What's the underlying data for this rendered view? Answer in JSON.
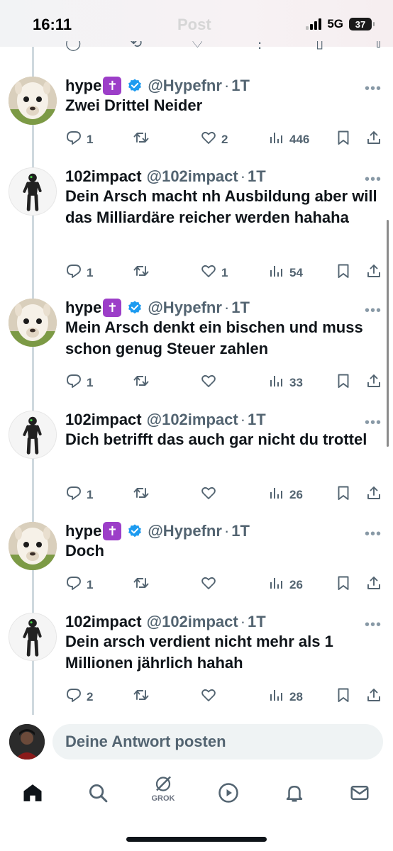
{
  "status_bar": {
    "time": "16:11",
    "ghost_title": "Post",
    "network": "5G",
    "battery": "37"
  },
  "tweets": [
    {
      "author": "hype",
      "emoji": "✝",
      "verified": true,
      "handle": "@Hypefnr",
      "time": "1T",
      "text": "Zwei Drittel Neider",
      "replies": "1",
      "retweets": "",
      "likes": "2",
      "views": "446"
    },
    {
      "author": "102impact",
      "emoji": "",
      "verified": false,
      "handle": "@102impact",
      "time": "1T",
      "text": "Dein Arsch macht nh Ausbildung aber will das Milliardäre reicher werden hahaha",
      "replies": "1",
      "retweets": "",
      "likes": "1",
      "views": "54"
    },
    {
      "author": "hype",
      "emoji": "✝",
      "verified": true,
      "handle": "@Hypefnr",
      "time": "1T",
      "text": "Mein Arsch denkt ein bischen und muss schon genug Steuer zahlen",
      "replies": "1",
      "retweets": "",
      "likes": "",
      "views": "33"
    },
    {
      "author": "102impact",
      "emoji": "",
      "verified": false,
      "handle": "@102impact",
      "time": "1T",
      "text": "Dich betrifft das auch gar nicht du trottel",
      "replies": "1",
      "retweets": "",
      "likes": "",
      "views": "26"
    },
    {
      "author": "hype",
      "emoji": "✝",
      "verified": true,
      "handle": "@Hypefnr",
      "time": "1T",
      "text": "Doch",
      "replies": "1",
      "retweets": "",
      "likes": "",
      "views": "26"
    },
    {
      "author": "102impact",
      "emoji": "",
      "verified": false,
      "handle": "@102impact",
      "time": "1T",
      "text": "Dein arsch verdient nicht mehr als 1 Millionen jährlich hahah",
      "replies": "2",
      "retweets": "",
      "likes": "",
      "views": "28"
    }
  ],
  "reply_bar": {
    "placeholder": "Deine Antwort posten"
  },
  "tabbar": {
    "grok_label": "GROK"
  },
  "colors": {
    "accent": "#1d9bf0",
    "secondary_text": "#536471",
    "thread_line": "#cfd9de"
  }
}
